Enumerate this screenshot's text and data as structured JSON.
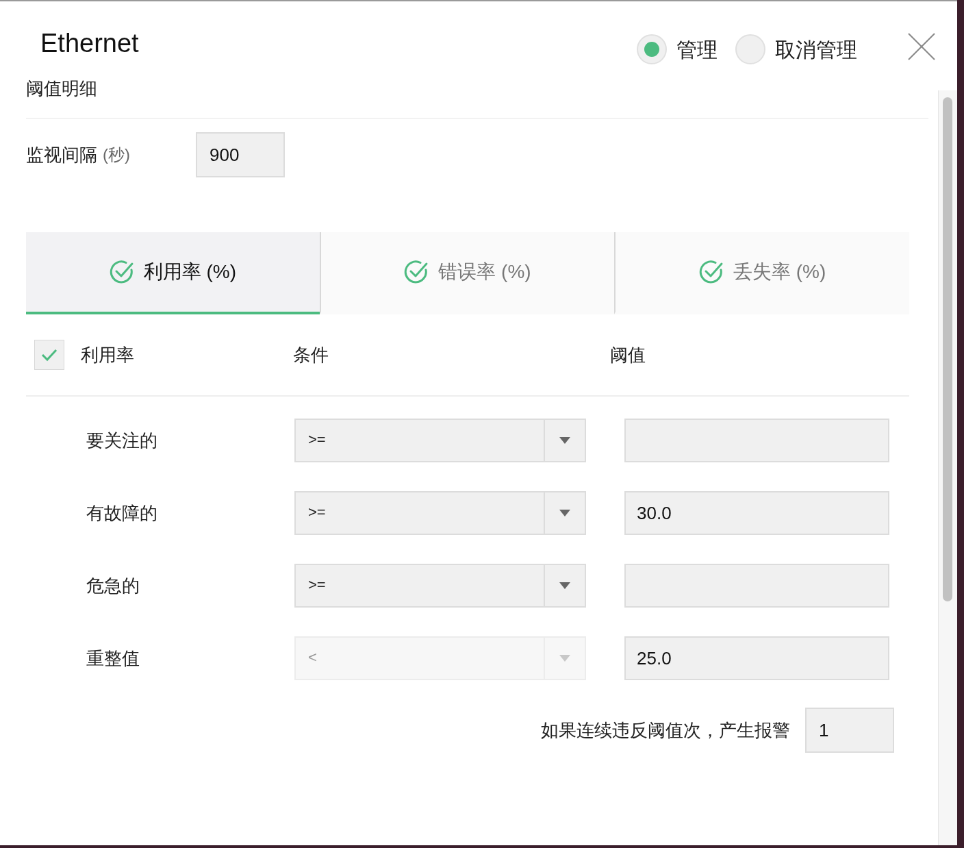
{
  "title": "Ethernet",
  "manage_options": [
    {
      "label": "管理",
      "selected": true
    },
    {
      "label": "取消管理",
      "selected": false
    }
  ],
  "section_title": "阈值明细",
  "interval": {
    "label": "监视间隔",
    "unit": "(秒)",
    "value": "900"
  },
  "tabs": [
    {
      "label": "利用率 (%)",
      "selected": true
    },
    {
      "label": "错误率 (%)",
      "selected": false
    },
    {
      "label": "丢失率 (%)",
      "selected": false
    }
  ],
  "table": {
    "enable_label": "利用率",
    "enabled": true,
    "condition_header": "条件",
    "threshold_header": "阈值",
    "rows": [
      {
        "label": "要关注的",
        "condition": ">=",
        "condition_disabled": false,
        "threshold": ""
      },
      {
        "label": "有故障的",
        "condition": ">=",
        "condition_disabled": false,
        "threshold": "30.0"
      },
      {
        "label": "危急的",
        "condition": ">=",
        "condition_disabled": false,
        "threshold": ""
      },
      {
        "label": "重整值",
        "condition": "<",
        "condition_disabled": true,
        "threshold": "25.0"
      }
    ]
  },
  "consecutive": {
    "label": "如果连续违反阈值次，产生报警",
    "value": "1"
  }
}
